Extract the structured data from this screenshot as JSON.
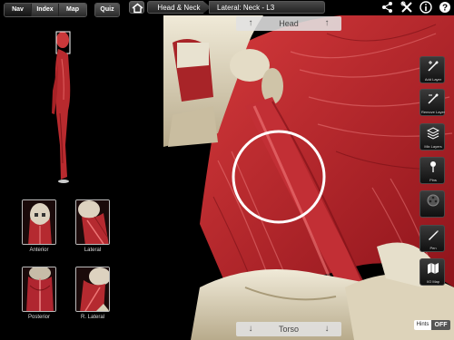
{
  "nav_tabs": [
    {
      "label": "Nav",
      "active": true
    },
    {
      "label": "Index",
      "active": false
    },
    {
      "label": "Map",
      "active": false
    }
  ],
  "quiz_label": "Quiz",
  "breadcrumb": {
    "region": "Head & Neck",
    "view": "Lateral: Neck - L3"
  },
  "views": [
    {
      "label": "Anterior"
    },
    {
      "label": "Lateral"
    },
    {
      "label": "Posterior"
    },
    {
      "label": "R. Lateral"
    }
  ],
  "viewer": {
    "nav_up_label": "Head",
    "nav_down_label": "Torso"
  },
  "tools": [
    {
      "label": "Add Layer",
      "icon": "add-layer-icon"
    },
    {
      "label": "Remove Layer",
      "icon": "remove-layer-icon"
    },
    {
      "label": "Mix Layers",
      "icon": "layers-icon"
    },
    {
      "label": "Pins",
      "icon": "pin-icon"
    },
    {
      "label": "",
      "icon": "film-reel-icon"
    },
    {
      "label": "Pen",
      "icon": "pen-icon"
    },
    {
      "label": "I/O Map",
      "icon": "map-icon"
    }
  ],
  "hints": {
    "label": "Hints",
    "state": "OFF"
  },
  "colors": {
    "muscle": "#b3202a",
    "bone": "#d8d0b8",
    "background": "#000000"
  }
}
